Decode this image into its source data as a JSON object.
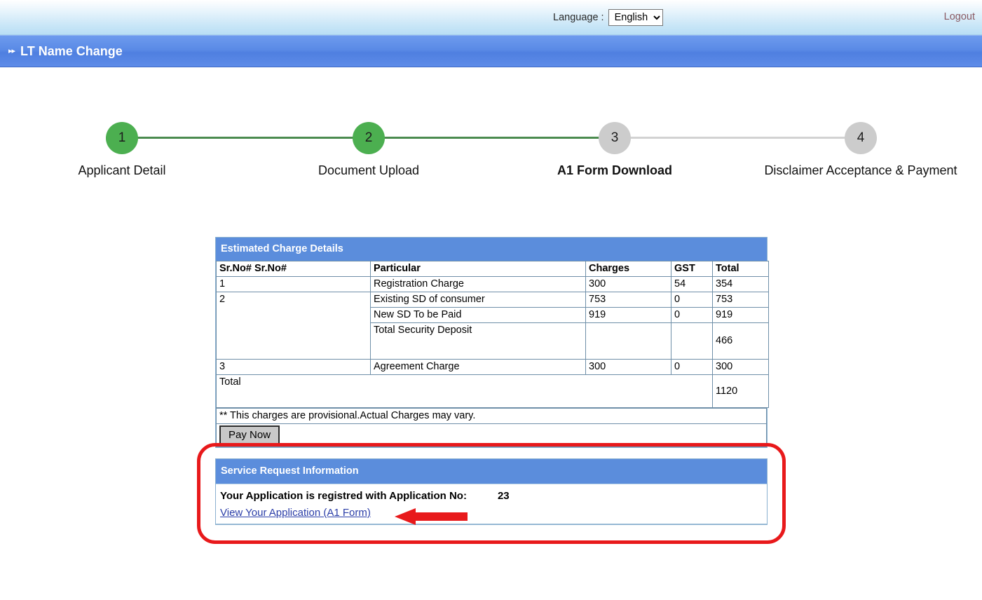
{
  "top_bar": {
    "language_label": "Language :",
    "language_selected": "English",
    "language_options": [
      "English"
    ],
    "logout_label": "Logout"
  },
  "title_bar": {
    "arrows": "▸▸",
    "title": "LT Name Change"
  },
  "stepper": {
    "steps": [
      {
        "number": "1",
        "label": "Applicant Detail",
        "state": "done",
        "current": false
      },
      {
        "number": "2",
        "label": "Document Upload",
        "state": "done",
        "current": false
      },
      {
        "number": "3",
        "label": "A1 Form Download",
        "state": "todo",
        "current": true
      },
      {
        "number": "4",
        "label": "Disclaimer Acceptance & Payment",
        "state": "todo",
        "current": false
      }
    ]
  },
  "charge_panel": {
    "heading": "Estimated Charge Details",
    "columns": [
      "Sr.No# Sr.No#",
      "Particular",
      "Charges",
      "GST",
      "Total"
    ],
    "rows": [
      {
        "srno": "1",
        "particular": "Registration Charge",
        "charges": "300",
        "gst": "54",
        "total": "354"
      },
      {
        "srno": "2",
        "particular": "Existing SD of consumer",
        "charges": "753",
        "gst": "0",
        "total": "753"
      },
      {
        "srno": "",
        "particular": "New SD To be Paid",
        "charges": "919",
        "gst": "0",
        "total": "919"
      },
      {
        "srno": "",
        "particular": "Total Security Deposit",
        "charges": "",
        "gst": "",
        "total": "466"
      },
      {
        "srno": "3",
        "particular": "Agreement Charge",
        "charges": "300",
        "gst": "0",
        "total": "300"
      }
    ],
    "total_label": "Total",
    "total_value": "1120",
    "note": "** This charges are provisional.Actual Charges may vary.",
    "pay_now_label": "Pay Now"
  },
  "service_panel": {
    "heading": "Service Request Information",
    "application_label": "Your Application is registred with Application No:",
    "application_number": "23",
    "view_application_link": "View Your Application (A1 Form)",
    "arrow_icon": "left-arrow-annotation"
  },
  "colors": {
    "panel_header_blue": "#5b8ddc",
    "title_bar_blue": "#5a8ae6",
    "step_done_green": "#4caf50",
    "step_todo_grey": "#cccccc",
    "connector_green": "#4b8b4f",
    "note_red": "#c0392b",
    "highlight_red": "#e8191b",
    "link_blue": "#2b3ea8",
    "logout_maroon": "#8a5a63"
  }
}
